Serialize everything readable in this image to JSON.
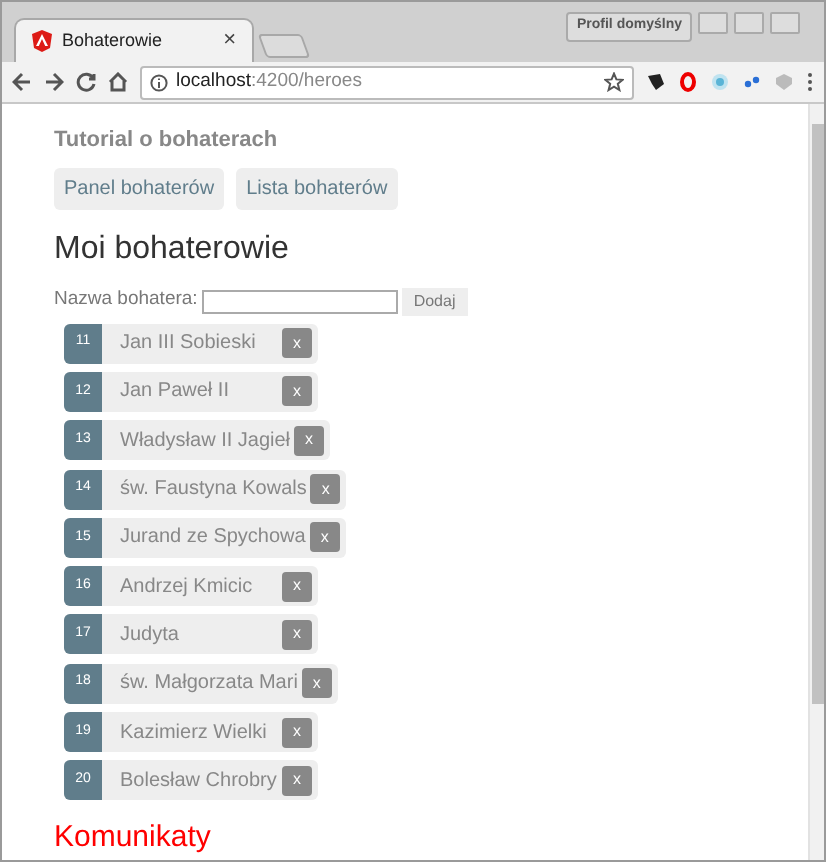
{
  "window": {
    "profile_button": "Profil domyślny"
  },
  "tabs": [
    {
      "title": "Bohaterowie",
      "close": "×",
      "selected": true
    }
  ],
  "address_bar": {
    "host": "localhost",
    "path": ":4200/heroes"
  },
  "page": {
    "title": "Tutorial o bohaterach",
    "nav": [
      {
        "label": "Panel bohaterów"
      },
      {
        "label": "Lista bohaterów"
      }
    ],
    "heading": "Moi bohaterowie",
    "add_form": {
      "label": "Nazwa bohatera:",
      "button": "Dodaj"
    },
    "heroes": [
      {
        "id": "11",
        "name": "Jan III Sobieski",
        "delete": "x"
      },
      {
        "id": "12",
        "name": "Jan Paweł II",
        "delete": "x"
      },
      {
        "id": "13",
        "name": "Władysław II Jagieł",
        "delete": "x"
      },
      {
        "id": "14",
        "name": "św. Faustyna Kowals",
        "delete": "x"
      },
      {
        "id": "15",
        "name": "Jurand ze Spychowa",
        "delete": "x"
      },
      {
        "id": "16",
        "name": "Andrzej Kmicic",
        "delete": "x"
      },
      {
        "id": "17",
        "name": "Judyta",
        "delete": "x"
      },
      {
        "id": "18",
        "name": "św. Małgorzata Mari",
        "delete": "x"
      },
      {
        "id": "19",
        "name": "Kazimierz Wielki",
        "delete": "x"
      },
      {
        "id": "20",
        "name": "Bolesław Chrobry",
        "delete": "x"
      }
    ],
    "messages_heading": "Komunikaty"
  }
}
